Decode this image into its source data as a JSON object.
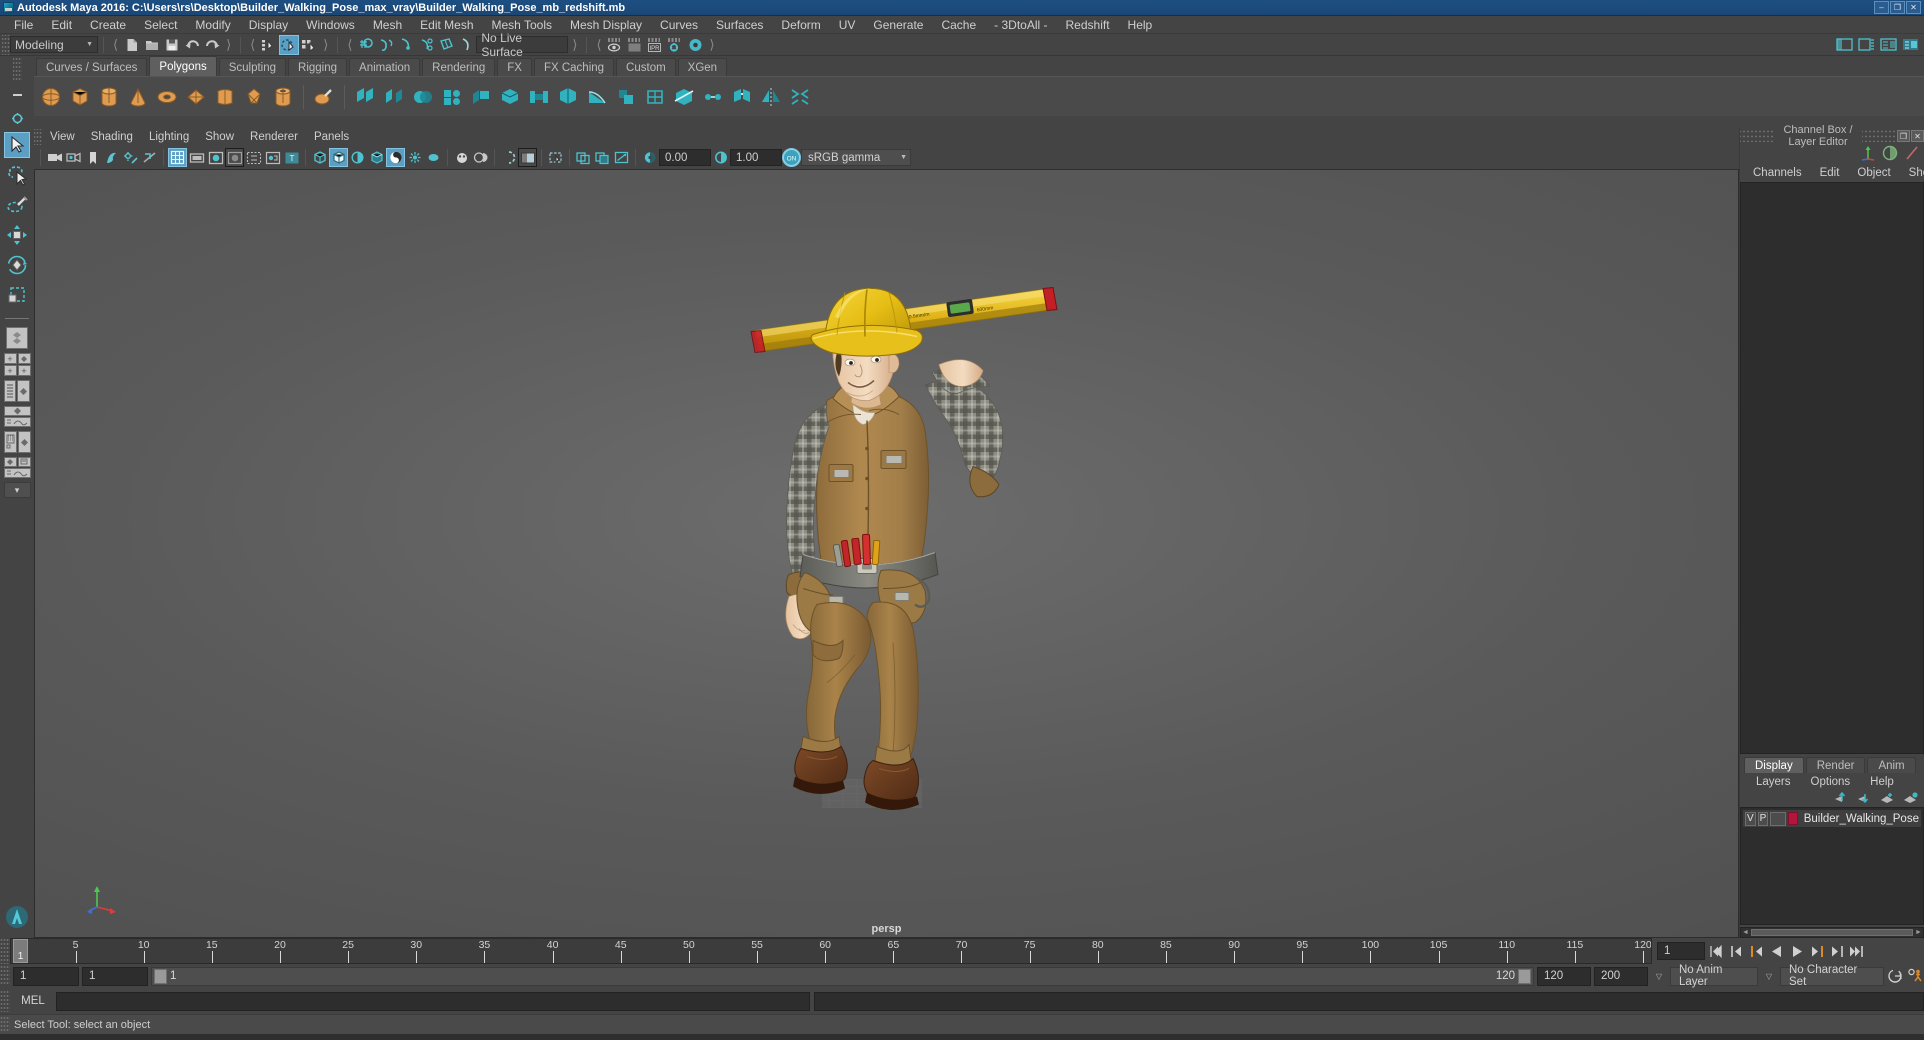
{
  "window": {
    "title": "Autodesk Maya 2016: C:\\Users\\rs\\Desktop\\Builder_Walking_Pose_max_vray\\Builder_Walking_Pose_mb_redshift.mb",
    "app_icon": "maya-logo-icon",
    "controls": {
      "minimize": "–",
      "maximize": "❐",
      "close": "✕"
    },
    "accent": "#1e4f82"
  },
  "menubar": {
    "items": [
      {
        "label": "File"
      },
      {
        "label": "Edit"
      },
      {
        "label": "Create"
      },
      {
        "label": "Select"
      },
      {
        "label": "Modify"
      },
      {
        "label": "Display"
      },
      {
        "label": "Windows"
      },
      {
        "label": "Mesh"
      },
      {
        "label": "Edit Mesh"
      },
      {
        "label": "Mesh Tools"
      },
      {
        "label": "Mesh Display"
      },
      {
        "label": "Curves"
      },
      {
        "label": "Surfaces"
      },
      {
        "label": "Deform"
      },
      {
        "label": "UV"
      },
      {
        "label": "Generate"
      },
      {
        "label": "Cache"
      },
      {
        "label": "- 3DtoAll -"
      },
      {
        "label": "Redshift"
      },
      {
        "label": "Help"
      }
    ]
  },
  "toolbar": {
    "menuset_value": "Modeling",
    "live_surface_value": "No Live Surface",
    "ipr_label": "IPR",
    "icons": [
      "new-scene-icon",
      "open-scene-icon",
      "save-scene-icon",
      "undo-icon",
      "redo-icon",
      "select-by-hierarchy-icon",
      "select-by-object-icon",
      "select-by-component-icon",
      "snap-to-grid-icon",
      "snap-to-curve-icon",
      "snap-to-point-icon",
      "snap-to-projected-center-icon",
      "snap-to-view-plane-icon",
      "make-live-icon",
      "render-current-frame-icon",
      "render-sequence-icon",
      "ipr-render-icon",
      "render-settings-icon",
      "hypershade-icon"
    ],
    "right_icons": [
      "workspace-icon",
      "sidebar-toggle-icon",
      "attribute-editor-icon",
      "tool-settings-icon"
    ]
  },
  "shelf": {
    "tabs": [
      {
        "label": "Curves / Surfaces",
        "active": false
      },
      {
        "label": "Polygons",
        "active": true
      },
      {
        "label": "Sculpting",
        "active": false
      },
      {
        "label": "Rigging",
        "active": false
      },
      {
        "label": "Animation",
        "active": false
      },
      {
        "label": "Rendering",
        "active": false
      },
      {
        "label": "FX",
        "active": false
      },
      {
        "label": "FX Caching",
        "active": false
      },
      {
        "label": "Custom",
        "active": false
      },
      {
        "label": "XGen",
        "active": false
      }
    ],
    "left_icons": [
      "shelf-collapse-icon",
      "shelf-options-icon"
    ],
    "poly_primitives": [
      "sphere-icon",
      "cube-icon",
      "cylinder-icon",
      "cone-icon",
      "torus-icon",
      "plane-icon",
      "disc-icon",
      "platonic-icon",
      "pipe-icon",
      "prism-icon",
      "pyramid-icon",
      "helix-icon"
    ],
    "poly_tools": [
      "combine-icon",
      "separate-icon",
      "booleans-icon",
      "smooth-icon",
      "extrude-icon",
      "bevel-icon",
      "bridge-icon",
      "append-icon",
      "wedge-icon",
      "duplicate-face-icon",
      "quad-draw-icon",
      "multi-cut-icon",
      "target-weld-icon",
      "connect-icon",
      "mirror-icon",
      "reduce-icon"
    ]
  },
  "toolbox": {
    "items": [
      {
        "name": "select-tool",
        "selected": true
      },
      {
        "name": "lasso-select-tool",
        "selected": false
      },
      {
        "name": "paint-select-tool",
        "selected": false
      },
      {
        "name": "move-tool",
        "selected": false
      },
      {
        "name": "rotate-tool",
        "selected": false
      },
      {
        "name": "scale-tool",
        "selected": false
      }
    ],
    "layout_presets": [
      "single-perspective-view",
      "four-view-layout",
      "outliner-persp-layout",
      "persp-graph-layout",
      "hypershade-persp-layout",
      "persp-graph-outliner-layout"
    ],
    "more_label": "▾"
  },
  "viewport": {
    "menus": [
      {
        "label": "View"
      },
      {
        "label": "Shading"
      },
      {
        "label": "Lighting"
      },
      {
        "label": "Show"
      },
      {
        "label": "Renderer"
      },
      {
        "label": "Panels"
      }
    ],
    "camera_label": "persp",
    "exposure_value": "0.00",
    "gamma_value": "1.00",
    "color_management_value": "sRGB gamma",
    "color_management_toggle": "ON",
    "toolbar_icons": [
      "select-camera-icon",
      "camera-attributes-icon",
      "bookmark-icon",
      "image-plane-icon",
      "two-sided-lighting-icon",
      "shadows-icon",
      "wireframe-icon",
      "smooth-shade-all-icon",
      "flat-shade-icon",
      "shaded-highlight-icon",
      "wireframe-on-shaded-icon",
      "xray-icon",
      "xray-joints-icon",
      "texture-icon",
      "use-all-lights-icon",
      "shadow-icon",
      "ao-icon",
      "motion-blur-icon",
      "multisample-icon",
      "isolate-select-icon",
      "grid-icon",
      "film-gate-icon",
      "resolution-gate-icon",
      "gate-mask-icon",
      "exposure-icon",
      "gamma-icon"
    ]
  },
  "channel_box": {
    "title": "Channel Box / Layer Editor",
    "window_buttons": [
      "undock-icon",
      "close-icon"
    ],
    "header_icons": [
      "axis-gizmo-icon",
      "paint-weights-icon",
      "graph-editor-icon"
    ],
    "menus": [
      {
        "label": "Channels"
      },
      {
        "label": "Edit"
      },
      {
        "label": "Object"
      },
      {
        "label": "Show"
      }
    ]
  },
  "layer_editor": {
    "tabs": [
      {
        "label": "Display",
        "active": true
      },
      {
        "label": "Render",
        "active": false
      },
      {
        "label": "Anim",
        "active": false
      }
    ],
    "menus": [
      {
        "label": "Layers"
      },
      {
        "label": "Options"
      },
      {
        "label": "Help"
      }
    ],
    "buttons": [
      "move-layer-up-icon",
      "move-layer-down-icon",
      "new-layer-from-selected-icon",
      "new-layer-icon"
    ],
    "layers": [
      {
        "visibility": "V",
        "playback": "P",
        "reference": "",
        "color": "#b5143c",
        "name": "Builder_Walking_Pose"
      }
    ]
  },
  "time_slider": {
    "current_frame": "1",
    "ticks": [
      5,
      10,
      15,
      20,
      25,
      30,
      35,
      40,
      45,
      50,
      55,
      60,
      65,
      70,
      75,
      80,
      85,
      90,
      95,
      100,
      105,
      110,
      115,
      120
    ],
    "range_start": 1,
    "range_end": 120,
    "frame_field": "1",
    "playback_buttons": [
      "go-to-start-icon",
      "step-back-keyframe-icon",
      "step-back-frame-icon",
      "play-backwards-icon",
      "play-forwards-icon",
      "step-forward-frame-icon",
      "step-forward-keyframe-icon",
      "go-to-end-icon"
    ]
  },
  "range_slider": {
    "anim_start": "1",
    "range_start": "1",
    "bar_start_value": "1",
    "bar_end_value": "120",
    "range_end": "120",
    "anim_end": "200",
    "anim_layer_value": "No Anim Layer",
    "character_set_value": "No Character Set",
    "right_icons": [
      "auto-keyframe-icon",
      "animation-preferences-icon"
    ]
  },
  "command_line": {
    "language_label": "MEL",
    "command_value": "",
    "placeholder": ""
  },
  "status_bar": {
    "message": "Select Tool: select an object"
  },
  "scene": {
    "object_name": "Builder_Walking_Pose",
    "description": "3D character model of a construction worker builder in walking pose carrying a yellow spirit level on his shoulder, wearing a yellow hard hat, tan coveralls, plaid shirt, and tool belt",
    "colors": {
      "helmet": "#e8c01c",
      "shirt_tan": "#a8824c",
      "plaid": "#8a8a82",
      "skin": "#e8c9a8",
      "level_yellow": "#e3b61a",
      "shoes": "#6b3d21",
      "pants": "#a07a46",
      "belt_gray": "#707070"
    }
  }
}
